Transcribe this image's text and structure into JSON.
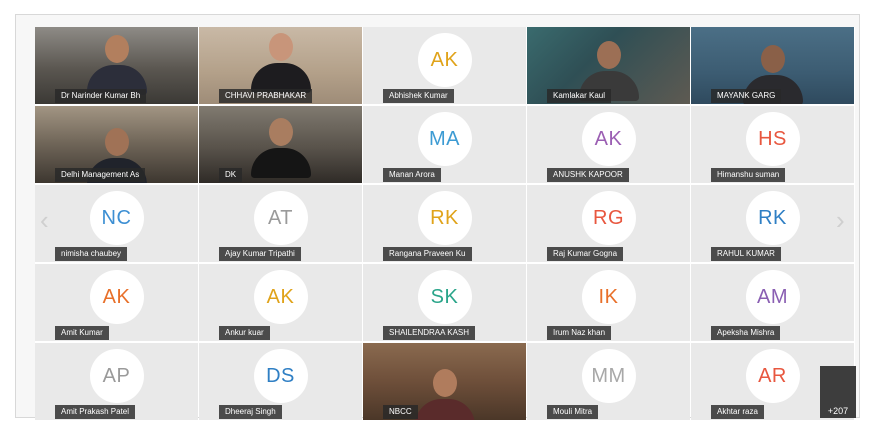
{
  "participants": [
    {
      "name": "Dr Narinder Kumar Bh",
      "video": true
    },
    {
      "name": "CHHAVI PRABHAKAR",
      "video": true
    },
    {
      "name": "Abhishek Kumar",
      "initials": "AK",
      "color": "#e0a31a"
    },
    {
      "name": "Kamlakar Kaul",
      "video": true
    },
    {
      "name": "MAYANK GARG",
      "video": true
    },
    {
      "name": "Delhi Management As",
      "video": true
    },
    {
      "name": "DK",
      "video": true
    },
    {
      "name": "Manan Arora",
      "initials": "MA",
      "color": "#3d9bd3"
    },
    {
      "name": "ANUSHK KAPOOR",
      "initials": "AK",
      "color": "#9b5fb3"
    },
    {
      "name": "Himanshu suman",
      "initials": "HS",
      "color": "#e8573f"
    },
    {
      "name": "nimisha chaubey",
      "initials": "NC",
      "color": "#3d8fd3"
    },
    {
      "name": "Ajay Kumar Tripathi",
      "initials": "AT",
      "color": "#9a9a9a"
    },
    {
      "name": "Rangana Praveen Ku",
      "initials": "RK",
      "color": "#e0a31a"
    },
    {
      "name": "Raj Kumar Gogna",
      "initials": "RG",
      "color": "#e8573f"
    },
    {
      "name": "RAHUL KUMAR",
      "initials": "RK",
      "color": "#2f7fc4"
    },
    {
      "name": "Amit Kumar",
      "initials": "AK",
      "color": "#e8702a"
    },
    {
      "name": "Ankur kuar",
      "initials": "AK",
      "color": "#e0a31a"
    },
    {
      "name": "SHAILENDRAA KASH",
      "initials": "SK",
      "color": "#2aa58a"
    },
    {
      "name": "Irum Naz khan",
      "initials": "IK",
      "color": "#e8702a"
    },
    {
      "name": "Apeksha Mishra",
      "initials": "AM",
      "color": "#8a5fb3"
    },
    {
      "name": "Amit Prakash Patel",
      "initials": "AP",
      "color": "#9a9a9a"
    },
    {
      "name": "Dheeraj Singh",
      "initials": "DS",
      "color": "#2f7fc4"
    },
    {
      "name": "NBCC",
      "video": true
    },
    {
      "name": "Mouli Mitra",
      "initials": "MM",
      "color": "#a8a8a8"
    },
    {
      "name": "Akhtar raza",
      "initials": "AR",
      "color": "#e8573f"
    }
  ],
  "more_participants": "+207",
  "navigation": {
    "prev_icon": "chevron-left-icon",
    "next_icon": "chevron-right-icon"
  }
}
